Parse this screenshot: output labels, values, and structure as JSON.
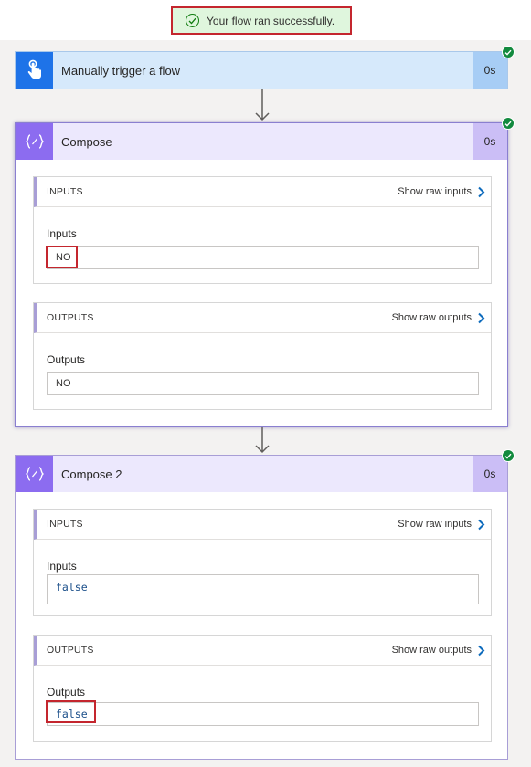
{
  "banner": {
    "text": "Your flow ran successfully."
  },
  "trigger": {
    "title": "Manually trigger a flow",
    "duration": "0s",
    "icon": "touch-hand-icon"
  },
  "compose1": {
    "title": "Compose",
    "duration": "0s",
    "icon": "curly-braces-icon",
    "inputs": {
      "section_label": "INPUTS",
      "raw_link": "Show raw inputs",
      "field_label": "Inputs",
      "value": "NO"
    },
    "outputs": {
      "section_label": "OUTPUTS",
      "raw_link": "Show raw outputs",
      "field_label": "Outputs",
      "value": "NO"
    }
  },
  "compose2": {
    "title": "Compose 2",
    "duration": "0s",
    "icon": "curly-braces-icon",
    "inputs": {
      "section_label": "INPUTS",
      "raw_link": "Show raw inputs",
      "field_label": "Inputs",
      "value": "false"
    },
    "outputs": {
      "section_label": "OUTPUTS",
      "raw_link": "Show raw outputs",
      "field_label": "Outputs",
      "value": "false"
    }
  },
  "colors": {
    "success": "#128a3e",
    "trigger_accent": "#1e73e8",
    "compose_accent": "#8c6cf0",
    "highlight": "#c4262e",
    "link_chevron": "#0f6cbd"
  }
}
